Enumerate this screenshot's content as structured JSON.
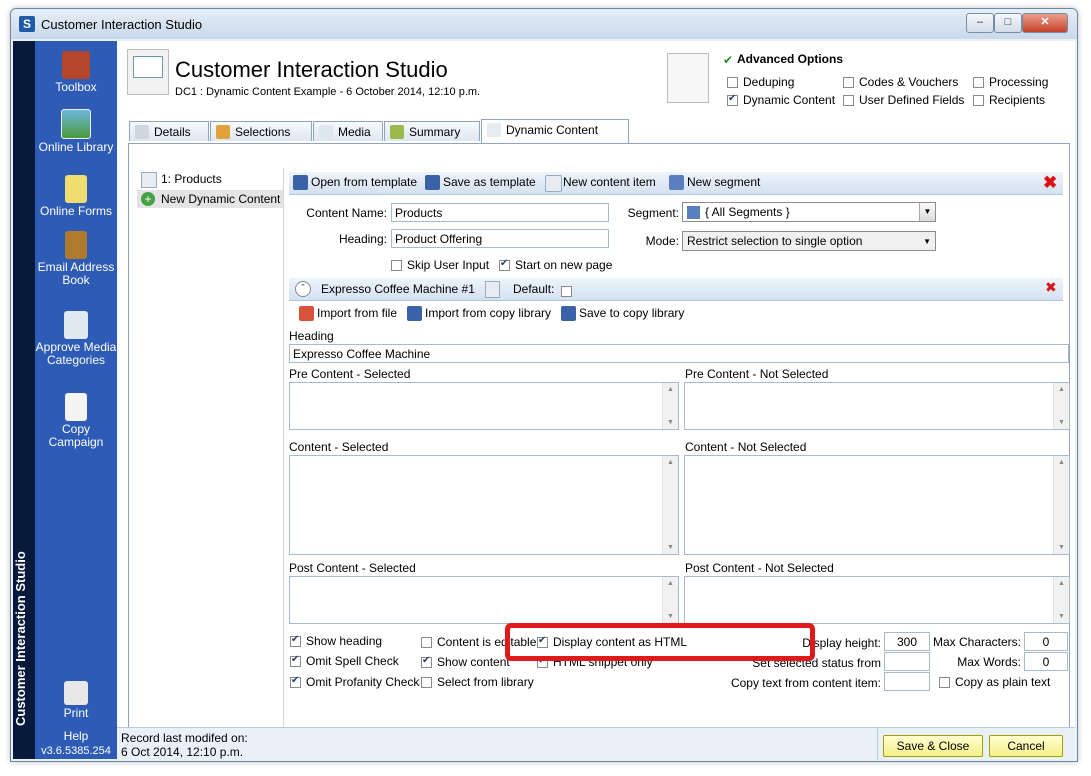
{
  "window": {
    "title": "Customer Interaction Studio",
    "app_icon_letter": "S",
    "min": "–",
    "max": "□",
    "close": "✕"
  },
  "sidebar": {
    "vertical_title": "Customer Interaction Studio",
    "items": [
      {
        "label": "Toolbox",
        "icon": "toolbox-icon"
      },
      {
        "label": "Online Library",
        "icon": "online-library-icon"
      },
      {
        "label": "Online Forms",
        "icon": "online-forms-icon"
      },
      {
        "label": "Email Address Book",
        "icon": "address-book-icon"
      },
      {
        "label": "Approve Media Categories",
        "icon": "approve-media-icon"
      },
      {
        "label": "Copy Campaign",
        "icon": "copy-campaign-icon"
      }
    ],
    "print_label": "Print",
    "help_label": "Help",
    "version": "v3.6.5385.254"
  },
  "header": {
    "title": "Customer Interaction Studio",
    "subtitle": "DC1 : Dynamic Content Example - 6 October 2014, 12:10 p.m."
  },
  "advanced": {
    "title": "Advanced Options",
    "options": [
      {
        "label": "Deduping",
        "checked": false
      },
      {
        "label": "Codes & Vouchers",
        "checked": false
      },
      {
        "label": "Processing",
        "checked": false
      },
      {
        "label": "Dynamic Content",
        "checked": true
      },
      {
        "label": "User Defined Fields",
        "checked": false
      },
      {
        "label": "Recipients",
        "checked": false
      }
    ]
  },
  "tabs": [
    "Details",
    "Selections",
    "Media",
    "Summary",
    "Dynamic Content"
  ],
  "left_list": [
    "1: Products",
    "New Dynamic Content"
  ],
  "toolbar": {
    "open_template": "Open from template",
    "save_template": "Save as template",
    "new_item": "New content item",
    "new_segment": "New segment"
  },
  "form": {
    "content_name_label": "Content Name:",
    "content_name_value": "Products",
    "heading_label": "Heading:",
    "heading_value": "Product Offering",
    "segment_label": "Segment:",
    "segment_value": "{ All Segments }",
    "mode_label": "Mode:",
    "mode_value": "Restrict selection to single option",
    "skip_user_input": "Skip User Input",
    "start_new_page": "Start on new page"
  },
  "item": {
    "title": "Expresso Coffee Machine #1",
    "default_label": "Default:",
    "import_file": "Import from file",
    "import_library": "Import from copy library",
    "save_library": "Save to copy library",
    "heading_label": "Heading",
    "heading_value": "Expresso Coffee Machine",
    "pre_selected": "Pre Content - Selected",
    "pre_not_selected": "Pre Content - Not Selected",
    "content_selected": "Content - Selected",
    "content_not_selected": "Content - Not Selected",
    "post_selected": "Post Content - Selected",
    "post_not_selected": "Post Content - Not Selected"
  },
  "bottom_options": {
    "show_heading": "Show heading",
    "omit_spell": "Omit Spell Check",
    "omit_profanity": "Omit Profanity Check",
    "content_editable": "Content is editable",
    "show_content": "Show content",
    "select_library": "Select from library",
    "display_html": "Display content as HTML",
    "html_snippet": "HTML snippet only",
    "display_height_label": "Display height:",
    "display_height_value": "300",
    "set_status_label": "Set selected status from",
    "copy_text_label": "Copy text from content item:",
    "max_chars_label": "Max Characters:",
    "max_chars_value": "0",
    "max_words_label": "Max Words:",
    "max_words_value": "0",
    "copy_plain": "Copy as plain text"
  },
  "status": {
    "line1": "Record last modifed on:",
    "line2": "6 Oct 2014, 12:10 p.m."
  },
  "buttons": {
    "save_close": "Save & Close",
    "cancel": "Cancel"
  },
  "colors": {
    "sidebar": "#2d5bb5",
    "highlight": "#e01a1a",
    "button_yellow": "#f5f08a"
  }
}
